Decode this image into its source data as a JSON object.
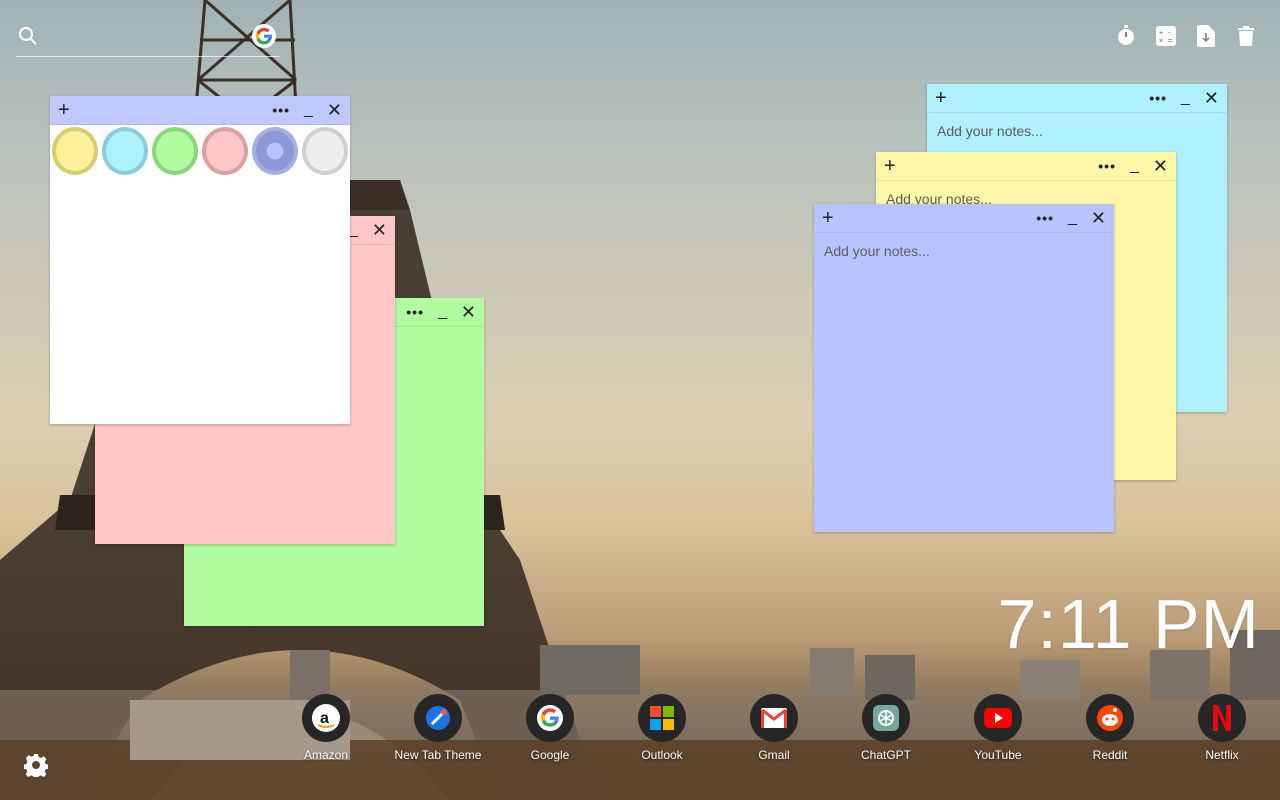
{
  "search": {
    "placeholder": "",
    "engine_icon": "google-icon"
  },
  "tools": [
    {
      "icon": "stopwatch-icon"
    },
    {
      "icon": "calculator-icon"
    },
    {
      "icon": "file-export-icon"
    },
    {
      "icon": "trash-icon"
    }
  ],
  "notes": {
    "placeholder": "Add your notes...",
    "plus_label": "+",
    "menu_label": "•••",
    "minimize_label": "_",
    "close_label": "✕",
    "colors": {
      "blue": "#aef0fb",
      "yellow": "#fff6a8",
      "lavender": "#b8c4ff",
      "green": "#b1fc9e",
      "pink": "#ffc7c8",
      "white": "#ffffff"
    },
    "palette": [
      "#fbf19a",
      "#aef0fb",
      "#b1fc9e",
      "#ffc7c8",
      "#8c99d9",
      "#eeeeee"
    ]
  },
  "clock": {
    "time": "7:11 PM"
  },
  "shortcuts": [
    {
      "label": "Amazon",
      "icon": "amazon-icon"
    },
    {
      "label": "New Tab Theme",
      "icon": "new-tab-theme-icon"
    },
    {
      "label": "Google",
      "icon": "google-icon"
    },
    {
      "label": "Outlook",
      "icon": "outlook-icon"
    },
    {
      "label": "Gmail",
      "icon": "gmail-icon"
    },
    {
      "label": "ChatGPT",
      "icon": "chatgpt-icon"
    },
    {
      "label": "YouTube",
      "icon": "youtube-icon"
    },
    {
      "label": "Reddit",
      "icon": "reddit-icon"
    },
    {
      "label": "Netflix",
      "icon": "netflix-icon"
    }
  ],
  "settings": {
    "icon": "gear-icon"
  }
}
